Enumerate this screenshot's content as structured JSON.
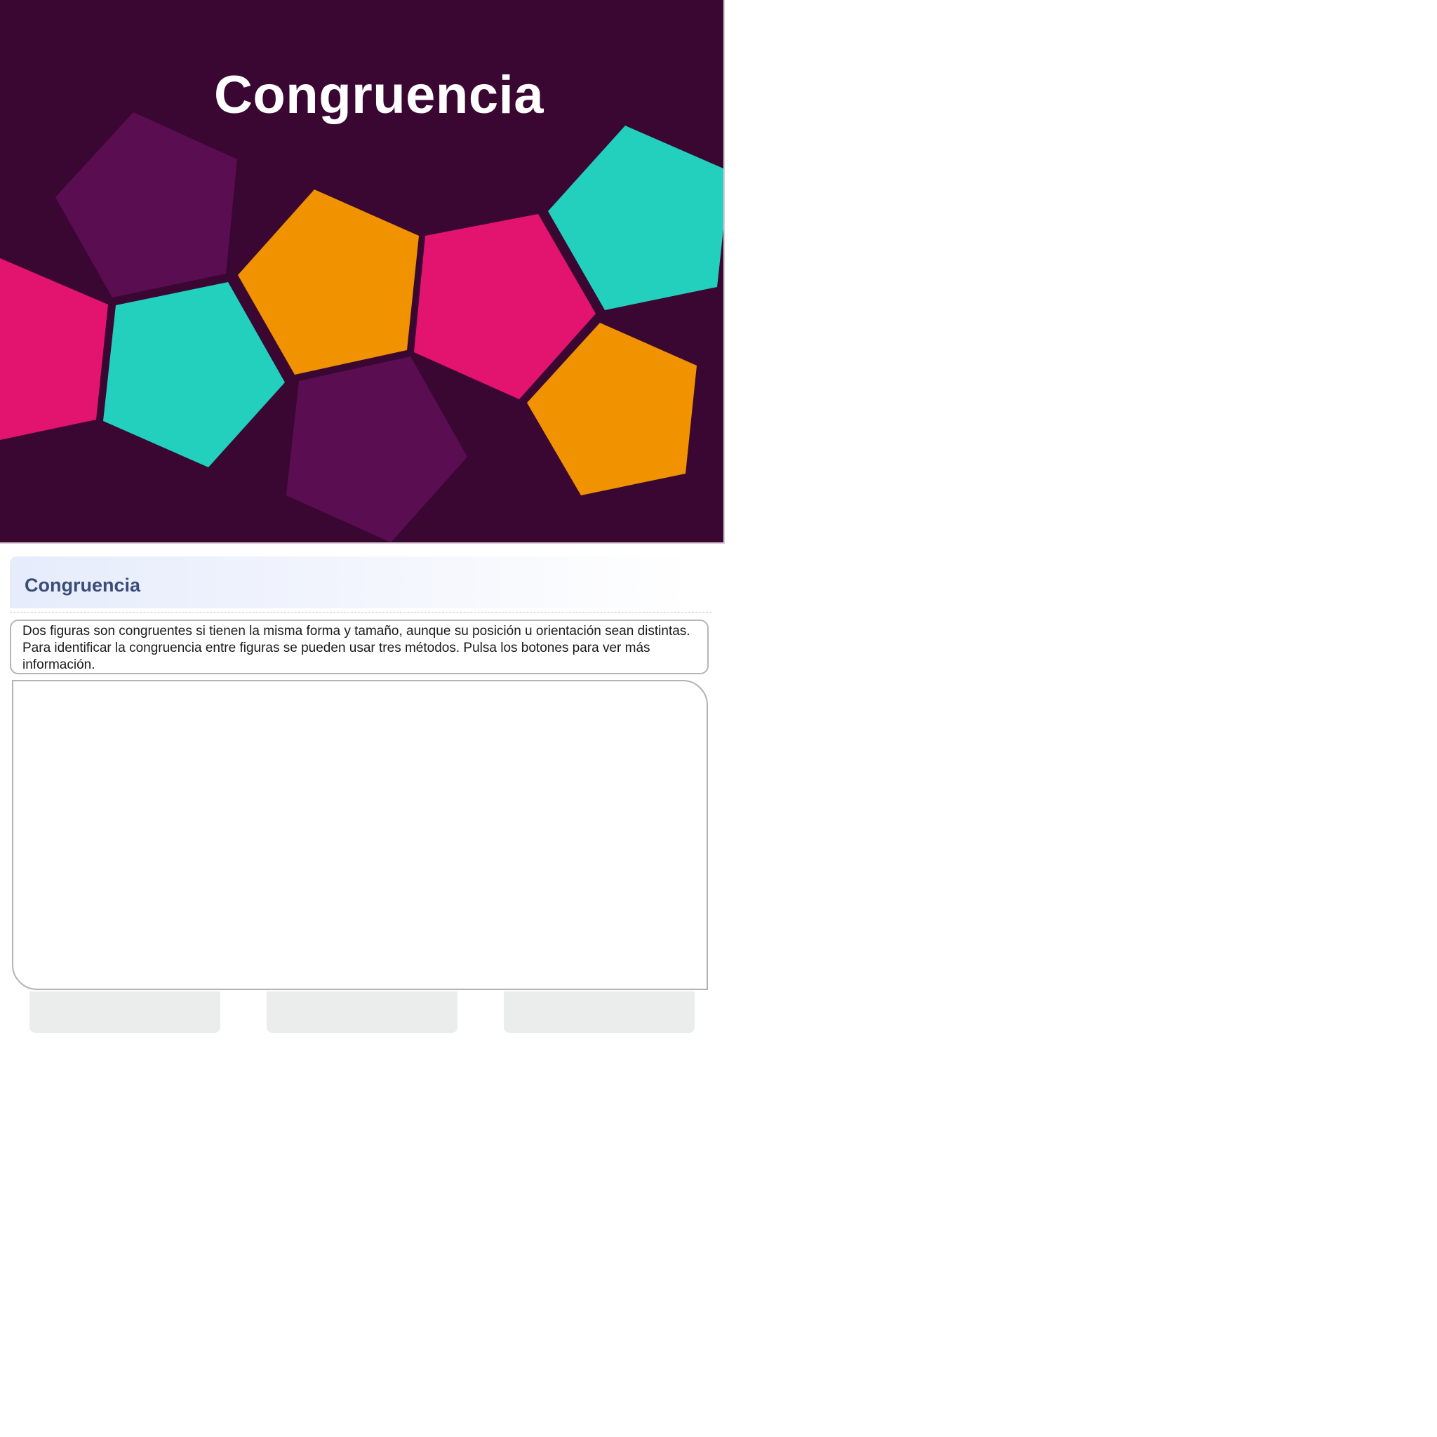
{
  "banner": {
    "title": "Congruencia",
    "background_color": "#3a0732",
    "shape_colors": [
      "#5b0d52",
      "#e31470",
      "#22d0bd",
      "#f19200"
    ]
  },
  "section": {
    "title": "Congruencia"
  },
  "intro": {
    "text": "Dos figuras son congruentes si tienen la misma forma y tamaño, aunque su posición u orientación sean distintas. Para identificar la congruencia entre figuras se pueden usar tres métodos. Pulsa los botones para ver más información."
  },
  "method_buttons": [
    {
      "label": ""
    },
    {
      "label": ""
    },
    {
      "label": ""
    }
  ]
}
